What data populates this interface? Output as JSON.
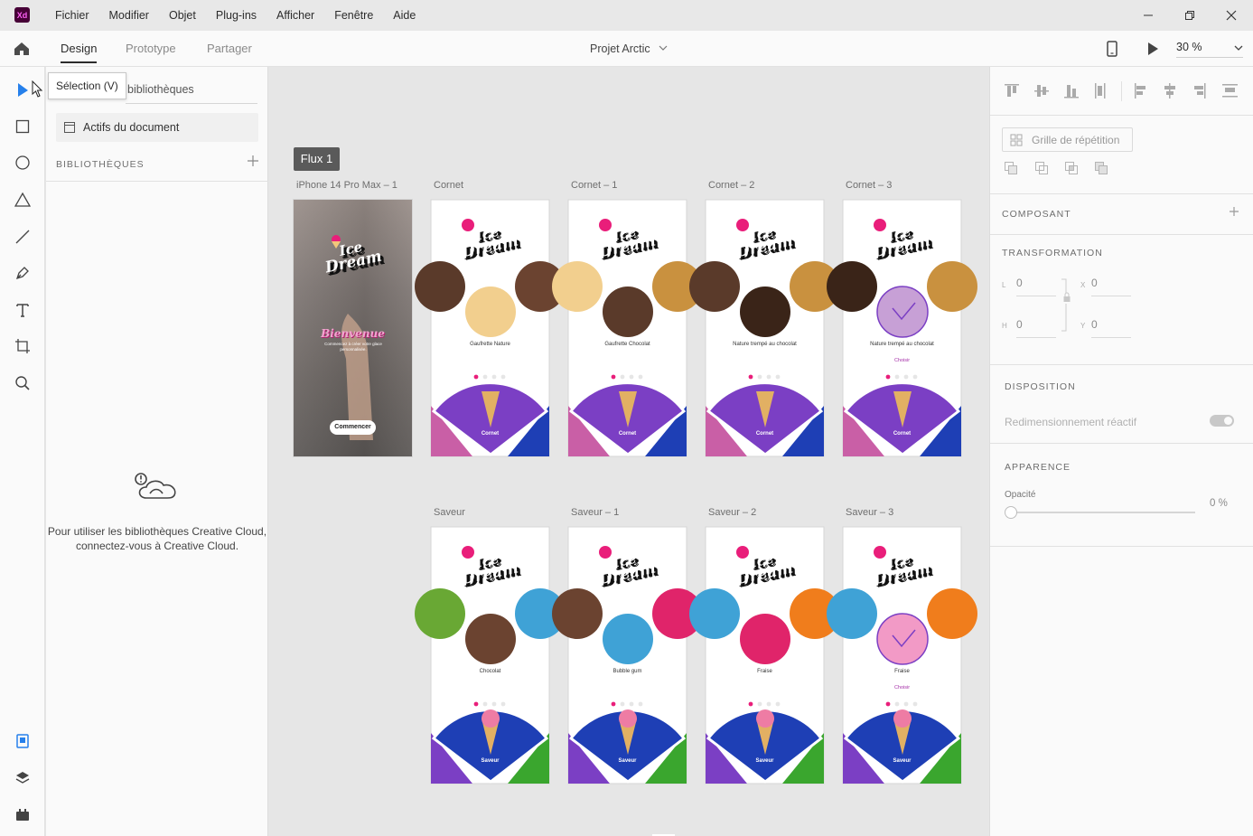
{
  "app": {
    "logo": "Xd"
  },
  "menubar": {
    "items": [
      "Fichier",
      "Modifier",
      "Objet",
      "Plug-ins",
      "Afficher",
      "Fenêtre",
      "Aide"
    ]
  },
  "topbar": {
    "tabs": [
      "Design",
      "Prototype",
      "Partager"
    ],
    "active_tab": "Design",
    "document_title": "Projet Arctic",
    "zoom": "30 %"
  },
  "tooltip": {
    "text": "Sélection (V)"
  },
  "libraries": {
    "search_placeholder": "bibliothèques",
    "document_assets": "Actifs du document",
    "section_title": "BIBLIOTHÈQUES",
    "empty_line1": "Pour utiliser les bibliothèques Creative Cloud,",
    "empty_line2": "connectez-vous à Creative Cloud."
  },
  "canvas": {
    "flow_label": "Flux 1",
    "brand_line1": "Ice",
    "brand_line2": "Dream",
    "welcome": {
      "title": "Bienvenue",
      "subtitle": "Commencez à créer votre glace personnalisée.",
      "button": "Commencer"
    },
    "artboards": [
      {
        "label": "iPhone 14 Pro Max – 1"
      },
      {
        "label": "Cornet",
        "caption": "Gaufrette Nature",
        "bottom": "Cornet",
        "choice": ""
      },
      {
        "label": "Cornet – 1",
        "caption": "Gaufrette Chocolat",
        "bottom": "Cornet",
        "choice": ""
      },
      {
        "label": "Cornet – 2",
        "caption": "Nature trempé au chocolat",
        "bottom": "Cornet",
        "choice": ""
      },
      {
        "label": "Cornet – 3",
        "caption": "Nature trempé au chocolat",
        "bottom": "Cornet",
        "choice": "Choisir"
      },
      {
        "label": "Saveur",
        "caption": "Chocolat",
        "bottom": "Saveur",
        "choice": ""
      },
      {
        "label": "Saveur – 1",
        "caption": "Bubble gum",
        "bottom": "Saveur",
        "choice": ""
      },
      {
        "label": "Saveur – 2",
        "caption": "Fraise",
        "bottom": "Saveur",
        "choice": ""
      },
      {
        "label": "Saveur – 3",
        "caption": "Fraise",
        "bottom": "Saveur",
        "choice": "Choisir"
      }
    ]
  },
  "properties": {
    "repeat_grid": "Grille de répétition",
    "component_title": "COMPOSANT",
    "transform_title": "TRANSFORMATION",
    "w_label": "L",
    "w_value": "0",
    "h_label": "H",
    "h_value": "0",
    "x_label": "X",
    "x_value": "0",
    "y_label": "Y",
    "y_value": "0",
    "layout_title": "DISPOSITION",
    "responsive_resize": "Redimensionnement réactif",
    "appearance_title": "APPARENCE",
    "opacity_label": "Opacité",
    "opacity_value": "0 %"
  },
  "colors": {
    "accent": "#2680eb",
    "brand_pink": "#e91e7a",
    "purple": "#7b3fc4",
    "blue": "#1e3fb5",
    "green": "#3aa62e"
  }
}
